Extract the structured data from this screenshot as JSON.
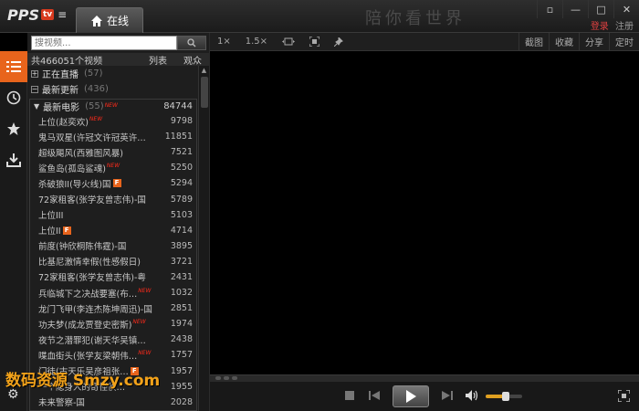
{
  "app": {
    "logo_text": "PPS",
    "logo_badge": "tv",
    "active_tab": "在线",
    "banner_text": "陪你看世界",
    "login": "登录",
    "register": "注册"
  },
  "sidebar_icons": [
    "list-icon",
    "clock-icon",
    "star-icon",
    "download-icon"
  ],
  "search": {
    "placeholder": "搜视频..."
  },
  "counts": {
    "total": "共466051个视频",
    "list_tab": "列表",
    "watchers_tab": "观众"
  },
  "categories": [
    {
      "label": "正在直播",
      "count": "(57)",
      "expanded": false
    },
    {
      "label": "最新更新",
      "count": "(436)",
      "expanded": true
    }
  ],
  "subcategory": {
    "label": "最新电影",
    "count": "(55)",
    "num": "84744"
  },
  "items": [
    {
      "title": "上位(赵奕欢)",
      "num": "9798",
      "new": true,
      "f": false
    },
    {
      "title": "鬼马双星(许冠文许冠英许…",
      "num": "11851",
      "new": false,
      "f": false
    },
    {
      "title": "超级飓风(西雅图风暴)",
      "num": "7521",
      "new": false,
      "f": false
    },
    {
      "title": "鲨鱼岛(孤岛鲨魂)",
      "num": "5250",
      "new": true,
      "f": false
    },
    {
      "title": "杀破狼II(导火线)国",
      "num": "5294",
      "new": false,
      "f": true
    },
    {
      "title": "72家租客(张学友曾志伟)-国",
      "num": "5789",
      "new": false,
      "f": false
    },
    {
      "title": "上位III",
      "num": "5103",
      "new": false,
      "f": false
    },
    {
      "title": "上位II",
      "num": "4714",
      "new": false,
      "f": true
    },
    {
      "title": "前度(钟欣桐陈伟霆)-国",
      "num": "3895",
      "new": false,
      "f": false
    },
    {
      "title": "比基尼激情幸假(性感假日)",
      "num": "3721",
      "new": false,
      "f": false
    },
    {
      "title": "72家租客(张学友曾志伟)-粤",
      "num": "2431",
      "new": false,
      "f": false
    },
    {
      "title": "兵临城下之决战要塞(布…",
      "num": "1032",
      "new": true,
      "f": false
    },
    {
      "title": "龙门飞甲(李连杰陈坤周迅)-国",
      "num": "2851",
      "new": false,
      "f": false
    },
    {
      "title": "功夫梦(成龙贾登史密斯)",
      "num": "1974",
      "new": true,
      "f": false
    },
    {
      "title": "夜节之潜罪犯(谢天华吴镇…",
      "num": "2438",
      "new": false,
      "f": false
    },
    {
      "title": "喋血街头(张学友梁朝伟…",
      "num": "1757",
      "new": true,
      "f": false
    },
    {
      "title": "门徒(古天乐吴彦祖张…",
      "num": "1957",
      "new": false,
      "f": true
    },
    {
      "title": "一个隐身人的奇怪侦…",
      "num": "1955",
      "new": false,
      "f": false
    },
    {
      "title": "未来警察-国",
      "num": "2028",
      "new": false,
      "f": false
    }
  ],
  "toolbar": {
    "speed_1x": "1×",
    "speed_15x": "1.5×",
    "right": [
      "截图",
      "收藏",
      "分享",
      "定时"
    ]
  },
  "player": {
    "volume_level": 0.55
  },
  "watermark": "数码资源 Smzy.com"
}
